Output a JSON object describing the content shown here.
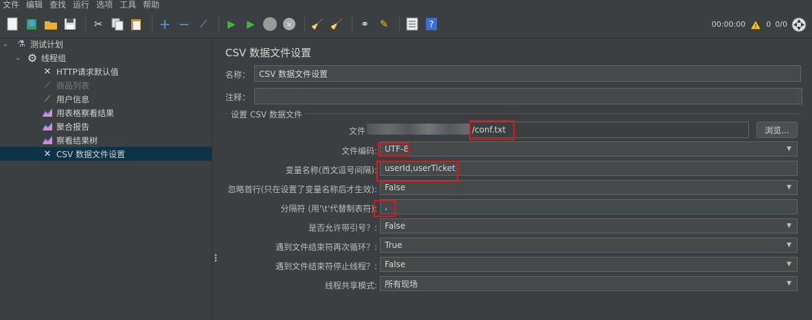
{
  "menu": [
    "文件",
    "编辑",
    "查找",
    "运行",
    "选项",
    "工具",
    "帮助"
  ],
  "toolbar": {
    "icons": [
      "new-icon",
      "templates-icon",
      "open-icon",
      "save-icon",
      "cut-icon",
      "copy-icon",
      "paste-icon",
      "expand-icon",
      "collapse-icon",
      "toggle-icon",
      "start-icon",
      "start-no-pause-icon",
      "stop-icon",
      "shutdown-icon",
      "clear-icon",
      "clear-all-icon",
      "search-icon",
      "reset-search-icon",
      "function-helper-icon",
      "help-icon"
    ],
    "timer": "00:00:00",
    "warnings": "0",
    "threads": "0/0"
  },
  "tree": {
    "items": [
      {
        "label": "测试计划",
        "icon": "flask-icon",
        "depth": 0,
        "expanded": true
      },
      {
        "label": "线程组",
        "icon": "gear-icon",
        "depth": 1,
        "expanded": true
      },
      {
        "label": "HTTP请求默认值",
        "icon": "wrench-icon",
        "depth": 2
      },
      {
        "label": "商品列表",
        "icon": "pipette-icon",
        "depth": 2,
        "disabled": true
      },
      {
        "label": "用户信息",
        "icon": "pipette-icon",
        "depth": 2
      },
      {
        "label": "用表格察看结果",
        "icon": "chart-icon",
        "depth": 2
      },
      {
        "label": "聚合报告",
        "icon": "chart-icon",
        "depth": 2
      },
      {
        "label": "察看结果树",
        "icon": "chart-icon",
        "depth": 2
      },
      {
        "label": "CSV 数据文件设置",
        "icon": "wrench-icon",
        "depth": 2,
        "selected": true
      }
    ]
  },
  "panel": {
    "title": "CSV 数据文件设置",
    "name_label": "名称：",
    "name_value": "CSV 数据文件设置",
    "comment_label": "注释：",
    "comment_value": "",
    "section_title": "设置 CSV 数据文件",
    "browse_label": "浏览...",
    "fields": [
      {
        "label": "文件",
        "value": "/conf.txt",
        "type": "text"
      },
      {
        "label": "文件编码:",
        "value": "UTF-8",
        "type": "select"
      },
      {
        "label": "变量名称(西文逗号间隔):",
        "value": "userId,userTicket",
        "type": "text"
      },
      {
        "label": "忽略首行(只在设置了变量名称后才生效):",
        "value": "False",
        "type": "select"
      },
      {
        "label": "分隔符 (用'\\t'代替制表符):",
        "value": ",",
        "type": "text"
      },
      {
        "label": "是否允许带引号？:",
        "value": "False",
        "type": "select"
      },
      {
        "label": "遇到文件结束符再次循环？:",
        "value": "True",
        "type": "select"
      },
      {
        "label": "遇到文件结束符停止线程？:",
        "value": "False",
        "type": "select"
      },
      {
        "label": "线程共享模式:",
        "value": "所有现场",
        "type": "select"
      }
    ]
  },
  "colors": {
    "background": "#3c3f41",
    "selection": "#0d3349",
    "highlight": "#e0161c"
  }
}
